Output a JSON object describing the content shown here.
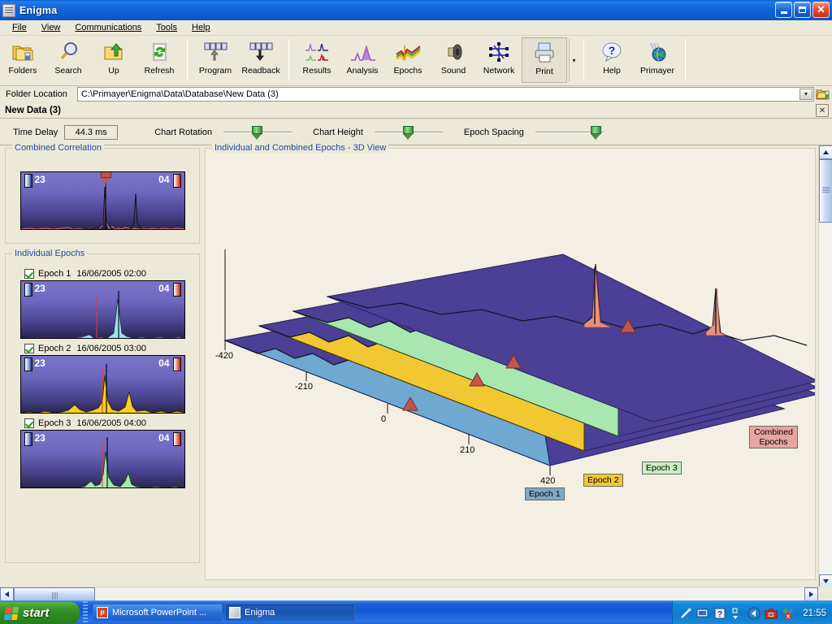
{
  "window": {
    "title": "Enigma",
    "icon": "app-icon",
    "minimize": "_",
    "maximize": "□",
    "close": "✕"
  },
  "menu": {
    "items": [
      {
        "label": "File",
        "accel": "F"
      },
      {
        "label": "View",
        "accel": "V"
      },
      {
        "label": "Communications",
        "accel": "C"
      },
      {
        "label": "Tools",
        "accel": "T"
      },
      {
        "label": "Help",
        "accel": "H"
      }
    ]
  },
  "toolbar": {
    "groups": [
      {
        "buttons": [
          {
            "label": "Folders",
            "icon": "folders-icon"
          },
          {
            "label": "Search",
            "icon": "magnifier-icon"
          },
          {
            "label": "Up",
            "icon": "up-folder-icon"
          },
          {
            "label": "Refresh",
            "icon": "refresh-icon"
          }
        ]
      },
      {
        "buttons": [
          {
            "label": "Program",
            "icon": "program-upload-icon"
          },
          {
            "label": "Readback",
            "icon": "readback-download-icon"
          }
        ]
      },
      {
        "buttons": [
          {
            "label": "Results",
            "icon": "results-chart-icon"
          },
          {
            "label": "Analysis",
            "icon": "analysis-peak-icon"
          },
          {
            "label": "Epochs",
            "icon": "epochs-waves-icon"
          },
          {
            "label": "Sound",
            "icon": "speaker-icon"
          },
          {
            "label": "Network",
            "icon": "network-nodes-icon"
          },
          {
            "label": "Print",
            "icon": "printer-icon"
          }
        ]
      },
      {
        "buttons": [
          {
            "label": "Help",
            "icon": "question-balloon-icon"
          },
          {
            "label": "Primayer",
            "icon": "globe-icon"
          }
        ]
      }
    ],
    "overflow": "▾"
  },
  "location": {
    "label": "Folder Location",
    "value": "C:\\Primayer\\Enigma\\Data\\Database\\New Data (3)",
    "dropdown": "▼",
    "go_icon": "open-folder-icon"
  },
  "document": {
    "name": "New Data (3)",
    "close": "✕"
  },
  "controls": {
    "time_delay_label": "Time Delay",
    "time_delay_value": "44.3 ms",
    "chart_rotation_label": "Chart Rotation",
    "chart_rotation_pos": 52,
    "chart_height_label": "Chart Height",
    "chart_height_pos": 52,
    "epoch_spacing_label": "Epoch Spacing",
    "epoch_spacing_pos": 94
  },
  "combined_correlation": {
    "title": "Combined Correlation",
    "left_code": "23",
    "right_code": "04",
    "marker_position_pct": 60
  },
  "individual_epochs": {
    "title": "Individual Epochs",
    "epochs": [
      {
        "checked": true,
        "name": "Epoch 1",
        "date": "16/06/2005 02:00",
        "left_code": "23",
        "right_code": "04",
        "color": "#9fdff0"
      },
      {
        "checked": true,
        "name": "Epoch 2",
        "date": "16/06/2005 03:00",
        "left_code": "23",
        "right_code": "04",
        "color": "#f5d020"
      },
      {
        "checked": true,
        "name": "Epoch 3",
        "date": "16/06/2005 04:00",
        "left_code": "23",
        "right_code": "04",
        "color": "#a8e8b0"
      }
    ]
  },
  "plot3d": {
    "title": "Individual and Combined Epochs - 3D View",
    "tags": [
      {
        "label": "Epoch 1",
        "color": "#7fa8c8"
      },
      {
        "label": "Epoch 2",
        "color": "#f2c832"
      },
      {
        "label": "Epoch 3",
        "color": "#c8f0c0"
      },
      {
        "label": "Combined\nEpochs",
        "line1": "Combined",
        "line2": "Epochs",
        "color": "#e8a4a0"
      }
    ]
  },
  "chart_data": {
    "type": "line",
    "title": "Individual and Combined Epochs - 3D View",
    "xlabel": "",
    "ylabel": "",
    "axis_ticks": [
      "-420",
      "-210",
      "0",
      "210",
      "420"
    ],
    "axis_values": [
      -420,
      -210,
      0,
      210,
      420
    ],
    "xlim": [
      -420,
      420
    ],
    "grid": true,
    "legend_position": "bottom-right",
    "surface_color": "#4b3f96",
    "series": [
      {
        "name": "Epoch 1",
        "color": "#6fa8d0",
        "peaks": [
          {
            "x": -120,
            "h": 0.52
          },
          {
            "x": 35,
            "h": 1.0
          },
          {
            "x": 150,
            "h": 0.3
          }
        ]
      },
      {
        "name": "Epoch 2",
        "color": "#f2c832",
        "peaks": [
          {
            "x": -130,
            "h": 0.48
          },
          {
            "x": 30,
            "h": 1.0
          },
          {
            "x": 140,
            "h": 0.34
          }
        ]
      },
      {
        "name": "Epoch 3",
        "color": "#a8e8b0",
        "peaks": [
          {
            "x": -125,
            "h": 0.3
          },
          {
            "x": 32,
            "h": 1.0
          },
          {
            "x": 145,
            "h": 0.36
          }
        ]
      },
      {
        "name": "Combined Epochs",
        "color": "#e8907f",
        "peaks": [
          {
            "x": 30,
            "h": 1.0
          },
          {
            "x": 205,
            "h": 0.62
          }
        ]
      }
    ],
    "markers": [
      {
        "series": "Epoch 1",
        "x": 0,
        "shape": "triangle",
        "color": "#c0574c"
      },
      {
        "series": "Epoch 2",
        "x": 0,
        "shape": "triangle",
        "color": "#c0574c"
      },
      {
        "series": "Epoch 3",
        "x": 0,
        "shape": "triangle",
        "color": "#c0574c"
      },
      {
        "series": "Combined Epochs",
        "x": 0,
        "shape": "triangle",
        "color": "#c0574c"
      }
    ]
  },
  "scrollbars": {
    "up": "▲",
    "down": "▼",
    "left": "◄",
    "right": "►"
  },
  "taskbar": {
    "start": "start",
    "tasks": [
      {
        "label": "Microsoft PowerPoint ...",
        "icon": "powerpoint-icon",
        "active": false
      },
      {
        "label": "Enigma",
        "icon": "enigma-icon",
        "active": true
      }
    ],
    "tray_icons": [
      "pen-icon",
      "monitor-icon",
      "help-icon",
      "chevron-icon",
      "back-arrow-icon",
      "toolbox-icon",
      "network-alert-icon"
    ],
    "clock": "21:55"
  }
}
